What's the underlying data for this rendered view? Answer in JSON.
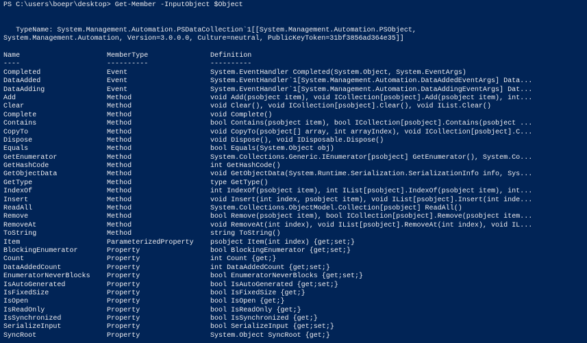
{
  "window": {
    "background": "#012456",
    "foreground": "#eeedf0"
  },
  "prompt": {
    "text": "PS C:\\users\\boepr\\desktop> Get-Member -InputObject $Object"
  },
  "typename": {
    "line1": "   TypeName: System.Management.Automation.PSDataCollection`1[[System.Management.Automation.PSObject,",
    "line2": "System.Management.Automation, Version=3.0.0.0, Culture=neutral, PublicKeyToken=31bf3856ad364e35]]"
  },
  "table": {
    "headers": {
      "name": "Name",
      "member_type": "MemberType",
      "definition": "Definition"
    },
    "underline": {
      "name": "----",
      "member_type": "----------",
      "definition": "----------"
    },
    "rows": [
      {
        "name": "Completed",
        "member_type": "Event",
        "definition": "System.EventHandler Completed(System.Object, System.EventArgs)"
      },
      {
        "name": "DataAdded",
        "member_type": "Event",
        "definition": "System.EventHandler`1[System.Management.Automation.DataAddedEventArgs] Data..."
      },
      {
        "name": "DataAdding",
        "member_type": "Event",
        "definition": "System.EventHandler`1[System.Management.Automation.DataAddingEventArgs] Dat..."
      },
      {
        "name": "Add",
        "member_type": "Method",
        "definition": "void Add(psobject item), void ICollection[psobject].Add(psobject item), int..."
      },
      {
        "name": "Clear",
        "member_type": "Method",
        "definition": "void Clear(), void ICollection[psobject].Clear(), void IList.Clear()"
      },
      {
        "name": "Complete",
        "member_type": "Method",
        "definition": "void Complete()"
      },
      {
        "name": "Contains",
        "member_type": "Method",
        "definition": "bool Contains(psobject item), bool ICollection[psobject].Contains(psobject ..."
      },
      {
        "name": "CopyTo",
        "member_type": "Method",
        "definition": "void CopyTo(psobject[] array, int arrayIndex), void ICollection[psobject].C..."
      },
      {
        "name": "Dispose",
        "member_type": "Method",
        "definition": "void Dispose(), void IDisposable.Dispose()"
      },
      {
        "name": "Equals",
        "member_type": "Method",
        "definition": "bool Equals(System.Object obj)"
      },
      {
        "name": "GetEnumerator",
        "member_type": "Method",
        "definition": "System.Collections.Generic.IEnumerator[psobject] GetEnumerator(), System.Co..."
      },
      {
        "name": "GetHashCode",
        "member_type": "Method",
        "definition": "int GetHashCode()"
      },
      {
        "name": "GetObjectData",
        "member_type": "Method",
        "definition": "void GetObjectData(System.Runtime.Serialization.SerializationInfo info, Sys..."
      },
      {
        "name": "GetType",
        "member_type": "Method",
        "definition": "type GetType()"
      },
      {
        "name": "IndexOf",
        "member_type": "Method",
        "definition": "int IndexOf(psobject item), int IList[psobject].IndexOf(psobject item), int..."
      },
      {
        "name": "Insert",
        "member_type": "Method",
        "definition": "void Insert(int index, psobject item), void IList[psobject].Insert(int inde..."
      },
      {
        "name": "ReadAll",
        "member_type": "Method",
        "definition": "System.Collections.ObjectModel.Collection[psobject] ReadAll()"
      },
      {
        "name": "Remove",
        "member_type": "Method",
        "definition": "bool Remove(psobject item), bool ICollection[psobject].Remove(psobject item..."
      },
      {
        "name": "RemoveAt",
        "member_type": "Method",
        "definition": "void RemoveAt(int index), void IList[psobject].RemoveAt(int index), void IL..."
      },
      {
        "name": "ToString",
        "member_type": "Method",
        "definition": "string ToString()"
      },
      {
        "name": "Item",
        "member_type": "ParameterizedProperty",
        "definition": "psobject Item(int index) {get;set;}"
      },
      {
        "name": "BlockingEnumerator",
        "member_type": "Property",
        "definition": "bool BlockingEnumerator {get;set;}"
      },
      {
        "name": "Count",
        "member_type": "Property",
        "definition": "int Count {get;}"
      },
      {
        "name": "DataAddedCount",
        "member_type": "Property",
        "definition": "int DataAddedCount {get;set;}"
      },
      {
        "name": "EnumeratorNeverBlocks",
        "member_type": "Property",
        "definition": "bool EnumeratorNeverBlocks {get;set;}"
      },
      {
        "name": "IsAutoGenerated",
        "member_type": "Property",
        "definition": "bool IsAutoGenerated {get;set;}"
      },
      {
        "name": "IsFixedSize",
        "member_type": "Property",
        "definition": "bool IsFixedSize {get;}"
      },
      {
        "name": "IsOpen",
        "member_type": "Property",
        "definition": "bool IsOpen {get;}"
      },
      {
        "name": "IsReadOnly",
        "member_type": "Property",
        "definition": "bool IsReadOnly {get;}"
      },
      {
        "name": "IsSynchronized",
        "member_type": "Property",
        "definition": "bool IsSynchronized {get;}"
      },
      {
        "name": "SerializeInput",
        "member_type": "Property",
        "definition": "bool SerializeInput {get;set;}"
      },
      {
        "name": "SyncRoot",
        "member_type": "Property",
        "definition": "System.Object SyncRoot {get;}"
      }
    ]
  }
}
